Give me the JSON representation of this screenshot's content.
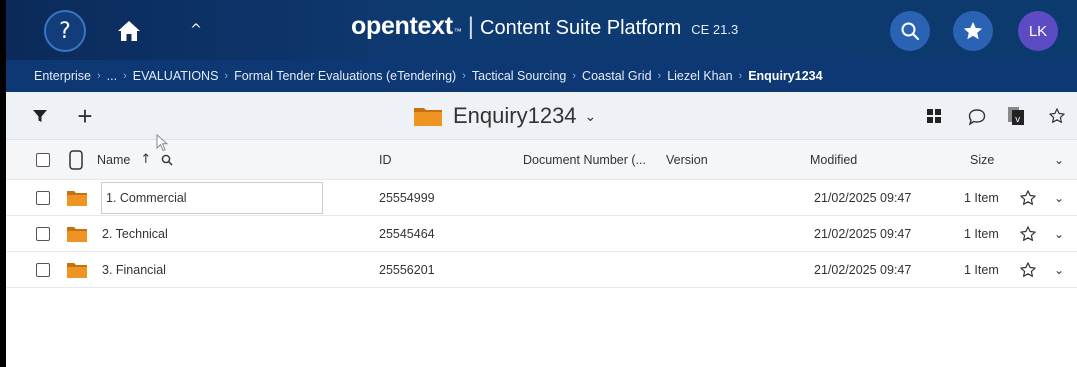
{
  "header": {
    "help_label": "?",
    "caret": "^",
    "brand_logo": "opentext",
    "brand_tm": "™",
    "brand_separator": "|",
    "product": "Content Suite Platform",
    "version": "CE 21.3",
    "avatar_initials": "LK",
    "icons": [
      "help-icon",
      "home-icon",
      "collapse-icon",
      "search-icon",
      "favorites-star-icon"
    ],
    "colors": {
      "bar": "#0b2a5a",
      "button": "#2b63b4",
      "avatar": "#5c4bc2"
    }
  },
  "breadcrumb": {
    "items": [
      "Enterprise",
      "...",
      "EVALUATIONS",
      "Formal Tender Evaluations (eTendering)",
      "Tactical Sourcing",
      "Coastal Grid",
      "Liezel Khan",
      "Enquiry1234"
    ],
    "separator": "›"
  },
  "toolbar": {
    "add_label": "+",
    "folder_title": "Enquiry1234",
    "dropdown": "⌄",
    "icons": [
      "filter-icon",
      "add-icon",
      "grid-view-icon",
      "comment-icon",
      "document-icon",
      "star-icon"
    ]
  },
  "table": {
    "headers": {
      "name": "Name",
      "sort_arrow": "↑",
      "id": "ID",
      "doc_number": "Document Number (...",
      "version": "Version",
      "modified": "Modified",
      "size": "Size"
    },
    "rows": [
      {
        "name": "1. Commercial",
        "id": "25554999",
        "doc_number": "",
        "version": "",
        "modified": "21/02/2025 09:47",
        "size": "1 Item"
      },
      {
        "name": "2. Technical",
        "id": "25545464",
        "doc_number": "",
        "version": "",
        "modified": "21/02/2025 09:47",
        "size": "1 Item"
      },
      {
        "name": "3. Financial",
        "id": "25556201",
        "doc_number": "",
        "version": "",
        "modified": "21/02/2025 09:47",
        "size": "1 Item"
      }
    ],
    "folder_color": "#e8871e"
  }
}
